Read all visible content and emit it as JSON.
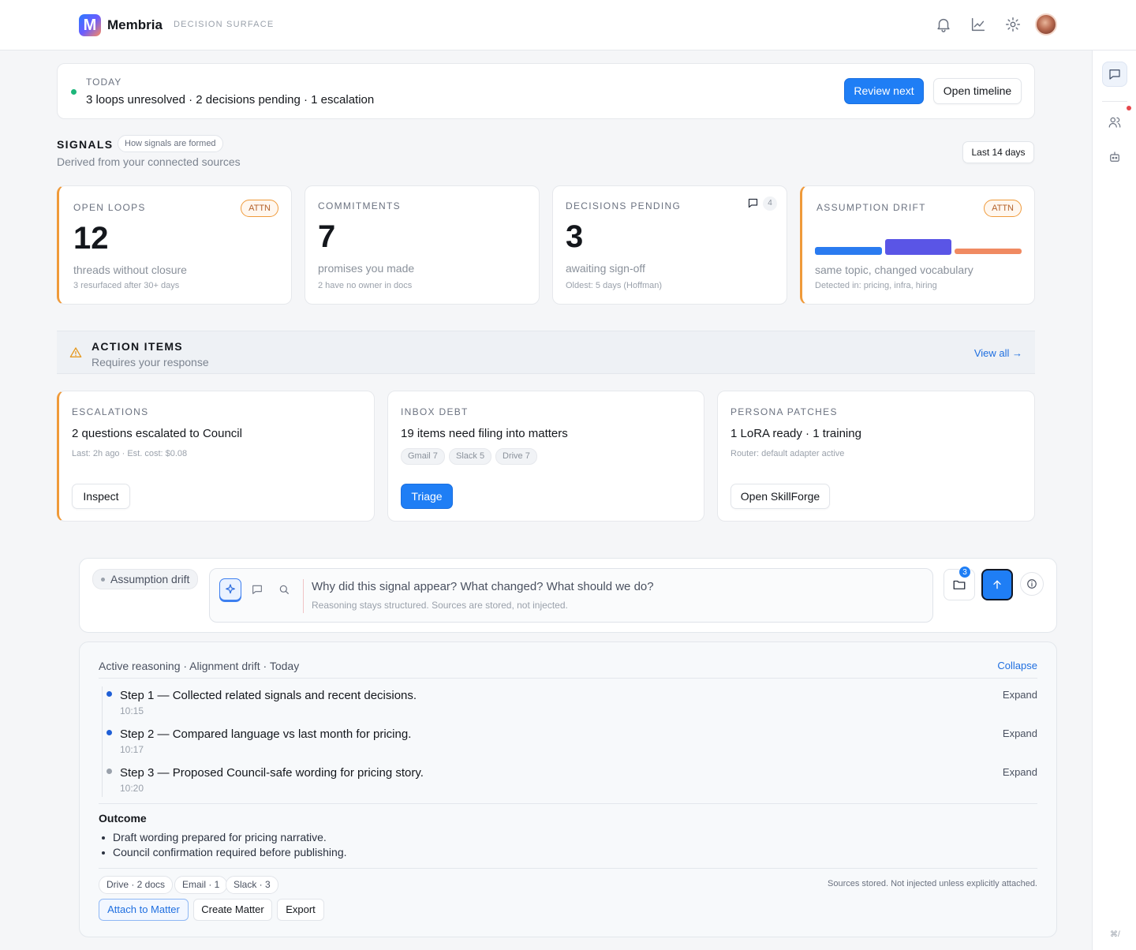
{
  "header": {
    "logo_letter": "M",
    "brand": "Membria",
    "subtitle": "DECISION SURFACE",
    "icons": [
      "bell-icon",
      "chart-icon",
      "gear-icon"
    ]
  },
  "today": {
    "label": "TODAY",
    "summary": "3 loops unresolved · 2 decisions pending · 1 escalation",
    "review_label": "Review next",
    "timeline_label": "Open timeline"
  },
  "signals": {
    "title": "SIGNALS",
    "how_label": "How signals are formed",
    "subtitle": "Derived from your connected sources",
    "range_label": "Last 14 days",
    "cards": [
      {
        "label": "OPEN LOOPS",
        "badge": "ATTN",
        "value": "12",
        "desc": "threads without closure",
        "note": "3 resurfaced after 30+ days"
      },
      {
        "label": "COMMITMENTS",
        "value": "7",
        "desc": "promises you made",
        "note": "2 have no owner in docs"
      },
      {
        "label": "DECISIONS PENDING",
        "comment_count": "4",
        "value": "3",
        "desc": "awaiting sign-off",
        "note": "Oldest: 5 days (Hoffman)"
      },
      {
        "label": "ASSUMPTION DRIFT",
        "badge": "ATTN",
        "desc": "same topic, changed vocabulary",
        "note": "Detected in: pricing, infra, hiring"
      }
    ],
    "drift_colors": [
      "#2a7bf0",
      "#5a55e6",
      "#f08a62"
    ]
  },
  "actions": {
    "title": "ACTION ITEMS",
    "subtitle": "Requires your response",
    "view_all": "View all →",
    "cards": [
      {
        "label": "ESCALATIONS",
        "main": "2 questions escalated to Council",
        "note": "Last: 2h ago · Est. cost: $0.08",
        "button": "Inspect"
      },
      {
        "label": "INBOX DEBT",
        "main": "19 items need filing into matters",
        "chips": [
          "Gmail 7",
          "Slack 5",
          "Drive 7"
        ],
        "button": "Triage"
      },
      {
        "label": "PERSONA PATCHES",
        "main": "1 LoRA ready · 1 training",
        "note": "Router: default adapter active",
        "button": "Open SkillForge"
      }
    ]
  },
  "composer": {
    "context_pill": "Assumption drift",
    "placeholder": "Why did this signal appear? What changed? What should we do?",
    "hint": "Reasoning stays structured. Sources are stored, not injected.",
    "attachments_count": "3"
  },
  "reasoning": {
    "header": "Active reasoning · Alignment drift · Today",
    "collapse": "Collapse",
    "expand_label": "Expand",
    "steps": [
      {
        "text": "Step 1 — Collected related signals and recent decisions.",
        "time": "10:15",
        "color": "#1f5fd6"
      },
      {
        "text": "Step 2 — Compared language vs last month for pricing.",
        "time": "10:17",
        "color": "#1f5fd6"
      },
      {
        "text": "Step 3 — Proposed Council-safe wording for pricing story.",
        "time": "10:20",
        "color": "#9aa1ab"
      }
    ],
    "outcome_title": "Outcome",
    "outcomes": [
      "Draft wording prepared for pricing narrative.",
      "Council confirmation required before publishing."
    ],
    "sources": [
      "Drive · 2 docs",
      "Email · 1",
      "Slack · 3"
    ],
    "sources_note": "Sources stored. Not injected unless explicitly attached.",
    "buttons": [
      "Attach to Matter",
      "Create Matter",
      "Export"
    ]
  },
  "rail": {
    "footer": "⌘/"
  }
}
